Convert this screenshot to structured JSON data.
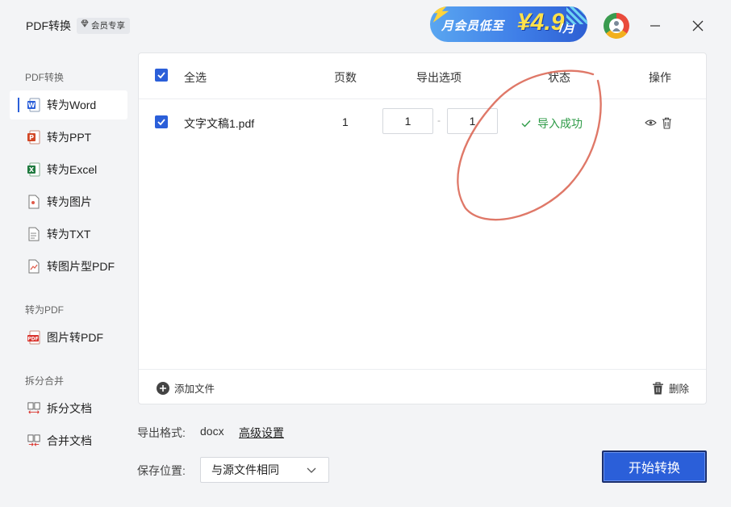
{
  "titlebar": {
    "app_title": "PDF转换",
    "vip_tag": "会员专享",
    "promo_text": "月会员低至",
    "promo_price": "¥4.9",
    "promo_unit": "/月"
  },
  "sidebar": {
    "groups": [
      {
        "title": "PDF转换"
      },
      {
        "title": "转为PDF"
      },
      {
        "title": "拆分合并"
      }
    ],
    "items": [
      {
        "label": "转为Word",
        "icon": "word-icon",
        "active": true
      },
      {
        "label": "转为PPT",
        "icon": "ppt-icon"
      },
      {
        "label": "转为Excel",
        "icon": "excel-icon"
      },
      {
        "label": "转为图片",
        "icon": "image-file-icon"
      },
      {
        "label": "转为TXT",
        "icon": "txt-file-icon"
      },
      {
        "label": "转图片型PDF",
        "icon": "image-pdf-icon"
      },
      {
        "label": "图片转PDF",
        "icon": "pdf-icon"
      },
      {
        "label": "拆分文档",
        "icon": "split-icon"
      },
      {
        "label": "合并文档",
        "icon": "merge-icon"
      }
    ]
  },
  "table": {
    "headers": {
      "select_all": "全选",
      "pages": "页数",
      "export_options": "导出选项",
      "status": "状态",
      "actions": "操作"
    },
    "rows": [
      {
        "checked": true,
        "filename": "文字文稿1.pdf",
        "pages": "1",
        "page_from": "1",
        "page_to": "1",
        "status": "导入成功"
      }
    ],
    "add_file": "添加文件",
    "delete": "删除"
  },
  "settings": {
    "format_label": "导出格式:",
    "format_value": "docx",
    "advanced": "高级设置",
    "save_label": "保存位置:",
    "save_value": "与源文件相同",
    "start_button": "开始转换"
  },
  "colors": {
    "accent": "#2b5fd9",
    "success": "#2e9b47",
    "annotation": "#d9604d"
  }
}
